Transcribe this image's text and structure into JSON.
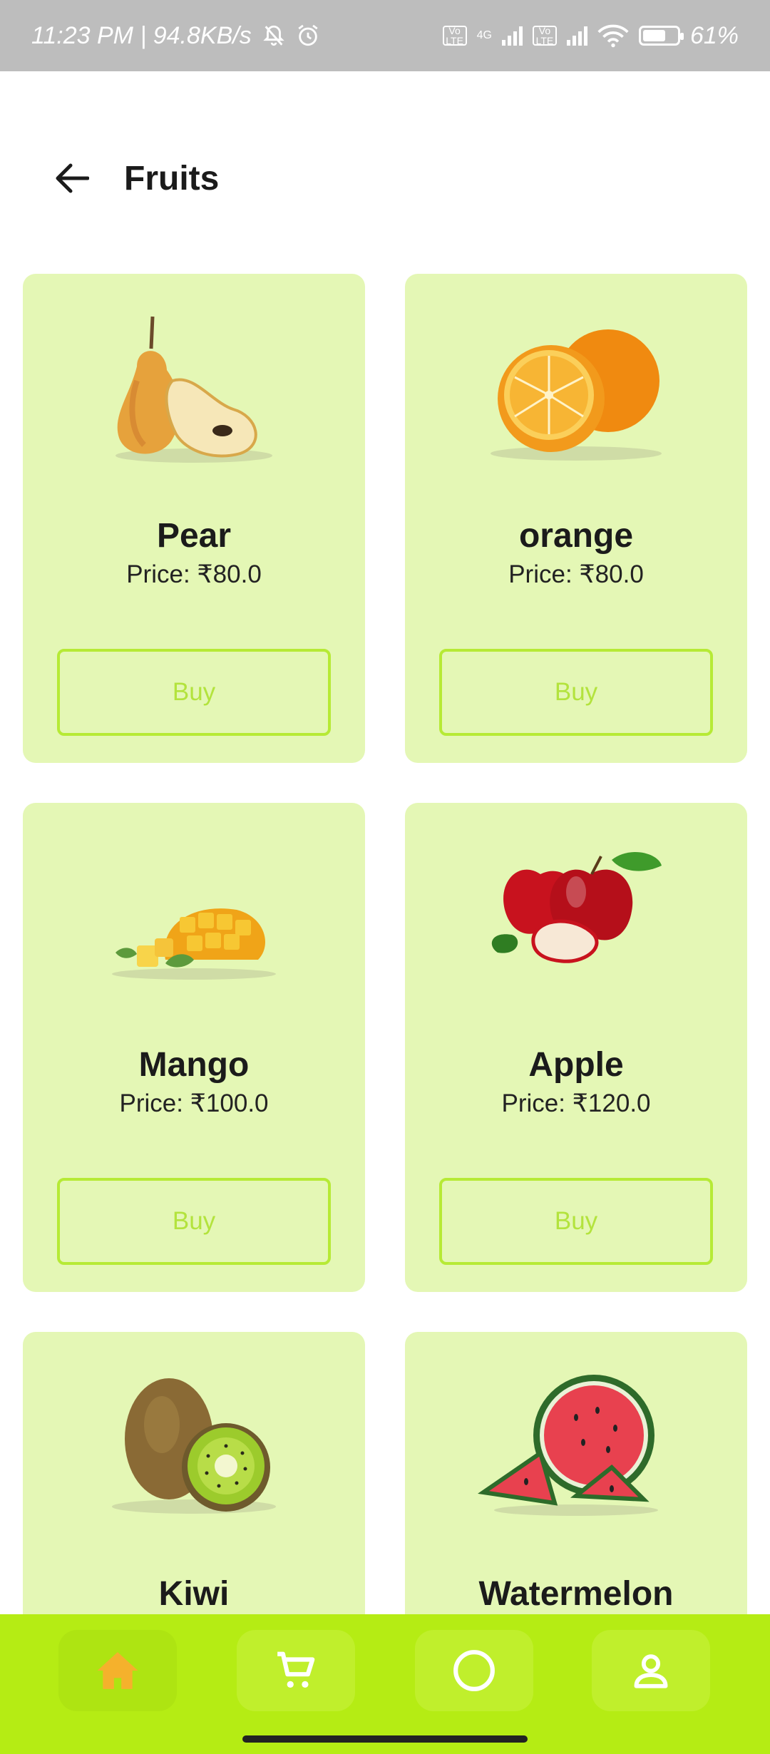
{
  "status_bar": {
    "time_info": "11:23 PM | 94.8KB/s",
    "network_4g": "4G",
    "volte_1": "Vo LTE",
    "volte_2": "Vo LTE",
    "battery": "61%"
  },
  "header": {
    "title": "Fruits"
  },
  "products": [
    {
      "name": "Pear",
      "price": "Price: ₹80.0",
      "buy_label": "Buy"
    },
    {
      "name": "orange",
      "price": "Price: ₹80.0",
      "buy_label": "Buy"
    },
    {
      "name": "Mango",
      "price": "Price: ₹100.0",
      "buy_label": "Buy"
    },
    {
      "name": "Apple",
      "price": "Price: ₹120.0",
      "buy_label": "Buy"
    },
    {
      "name": "Kiwi",
      "price": "",
      "buy_label": ""
    },
    {
      "name": "Watermelon",
      "price": "",
      "buy_label": ""
    }
  ],
  "bottom_nav": {
    "items": [
      "home-icon",
      "cart-icon",
      "circle-icon",
      "profile-icon"
    ],
    "active": "home-icon"
  },
  "colors": {
    "card_bg": "#e4f7b5",
    "accent": "#b5ec14",
    "button_border": "#b6ea35",
    "active_home_icon": "#f5b12c"
  }
}
